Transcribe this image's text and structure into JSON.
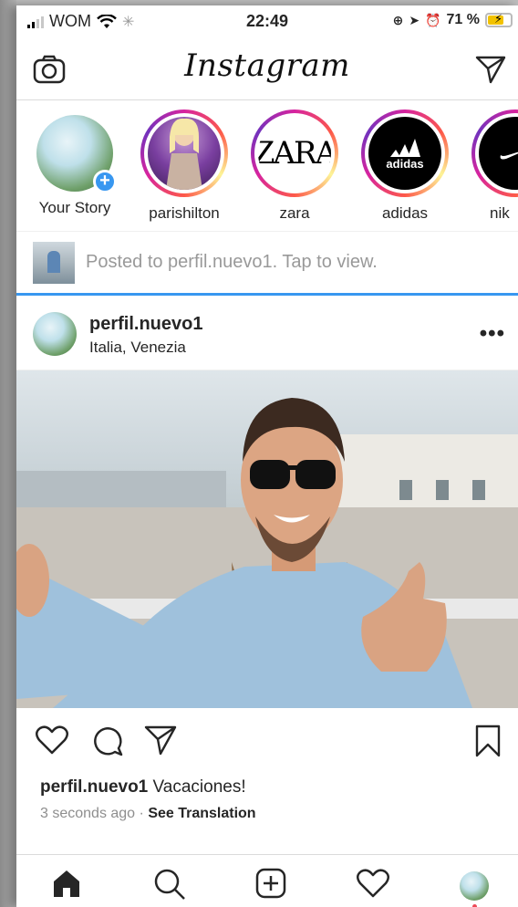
{
  "status_bar": {
    "carrier": "WOM",
    "time": "22:49",
    "battery": "71 %",
    "battery_level": 0.71
  },
  "header": {
    "logo": "Instagram",
    "camera_icon": "camera-icon",
    "direct_icon": "paper-plane-icon"
  },
  "stories": [
    {
      "name": "Your Story",
      "own": true
    },
    {
      "name": "parishilton"
    },
    {
      "name": "zara",
      "logo_text": "ZARA"
    },
    {
      "name": "adidas",
      "logo_text": "adidas"
    },
    {
      "name": "nik"
    }
  ],
  "notice": {
    "text": "Posted to perfil.nuevo1. Tap to view."
  },
  "post": {
    "username": "perfil.nuevo1",
    "location": "Italia, Venezia",
    "more": "•••",
    "caption_user": "perfil.nuevo1",
    "caption_text": "Vacaciones!",
    "time_ago": "3 seconds ago",
    "separator": "·",
    "translate": "See Translation"
  },
  "tab_bar": {
    "items": [
      "home-icon",
      "search-icon",
      "new-post-icon",
      "activity-icon",
      "profile-avatar"
    ]
  },
  "colors": {
    "accent_blue": "#3897f0",
    "text": "#262626",
    "muted": "#8e8e8e"
  }
}
